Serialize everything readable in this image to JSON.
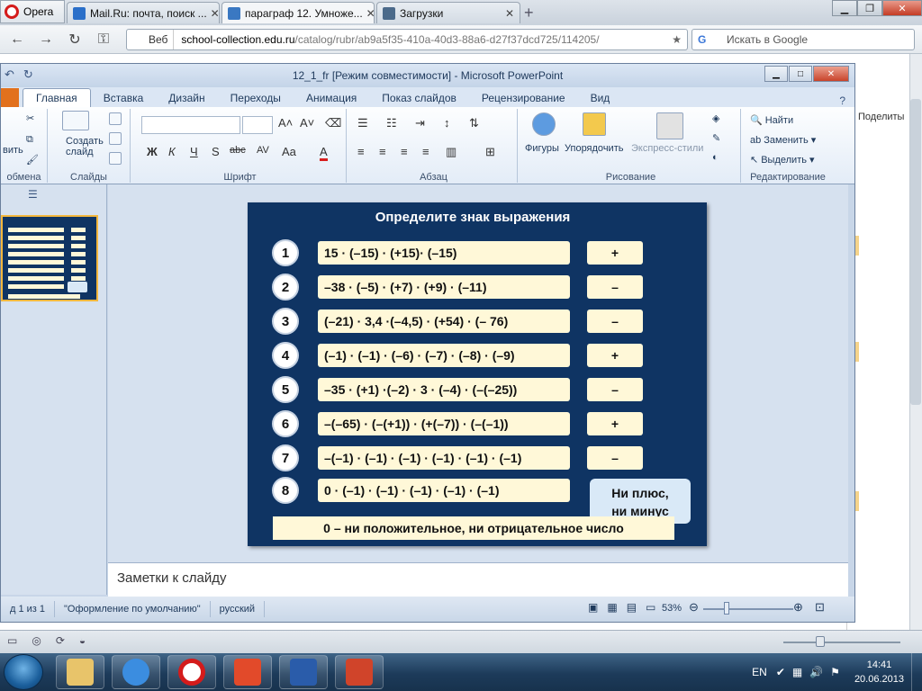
{
  "browser": {
    "menu_label": "Opera",
    "tabs": [
      {
        "label": "Mail.Ru: почта, поиск ..."
      },
      {
        "label": "параграф 12. Умноже..."
      },
      {
        "label": "Загрузки"
      }
    ],
    "address": {
      "web_label": "Веб",
      "host": "school-collection.edu.ru",
      "path": "/catalog/rubr/ab9a5f35-410a-40d3-88a6-d27f37dcd725/114205/"
    },
    "search_placeholder": "Искать в Google",
    "right_pane_text": "Поделиты"
  },
  "ppt": {
    "title": "12_1_fr [Режим совместимости] - Microsoft PowerPoint",
    "ribbon_tabs": [
      "Главная",
      "Вставка",
      "Дизайн",
      "Переходы",
      "Анимация",
      "Показ слайдов",
      "Рецензирование",
      "Вид"
    ],
    "groups": {
      "clipboard": "обмена",
      "slides": "Слайды",
      "font": "Шрифт",
      "paragraph": "Абзац",
      "drawing": "Рисование",
      "editing": "Редактирование"
    },
    "buttons": {
      "paste": "вить",
      "create_slide_1": "Создать",
      "create_slide_2": "слайд",
      "shapes": "Фигуры",
      "arrange": "Упорядочить",
      "quick_styles": "Экспресс-стили",
      "find": "Найти",
      "replace": "Заменить",
      "select": "Выделить"
    },
    "font_format": [
      "Ж",
      "К",
      "Ч",
      "S",
      "abc",
      "AV",
      "Aa",
      "A"
    ],
    "notes_placeholder": "Заметки к слайду",
    "status": {
      "slide": "д 1 из 1",
      "theme": "\"Оформление по умолчанию\"",
      "language": "русский",
      "zoom": "53%"
    }
  },
  "slide": {
    "title": "Определите знак выражения",
    "rows": [
      {
        "num": "1",
        "expr": "15 · (–15) · (+15)· (–15)",
        "sign": "+"
      },
      {
        "num": "2",
        "expr": "–38 · (–5) · (+7) · (+9) · (–11)",
        "sign": "–"
      },
      {
        "num": "3",
        "expr": "(–21) · 3,4 ·(–4,5) · (+54) · (– 76)",
        "sign": "–"
      },
      {
        "num": "4",
        "expr": "(–1) · (–1) · (–6) · (–7) · (–8) · (–9)",
        "sign": "+"
      },
      {
        "num": "5",
        "expr": "–35 · (+1) ·(–2) · 3 · (–4) · (–(–25))",
        "sign": "–"
      },
      {
        "num": "6",
        "expr": "–(–65) · (–(+1)) · (+(–7)) · (–(–1))",
        "sign": "+"
      },
      {
        "num": "7",
        "expr": "–(–1) · (–1) · (–1) · (–1) · (–1) · (–1)",
        "sign": "–"
      },
      {
        "num": "8",
        "expr": "0 · (–1) · (–1) · (–1) · (–1) · (–1)",
        "sign": ""
      }
    ],
    "np_line1": "Ни плюс,",
    "np_line2": "ни минус",
    "zero_note": "0 – ни положительное, ни отрицательное  число"
  },
  "taskbar": {
    "lang": "EN",
    "time": "14:41",
    "date": "20.06.2013"
  },
  "colors": {
    "slide_bg": "#0f3463",
    "cell_bg": "#fff8d8",
    "ribbon_accent": "#e2711d"
  }
}
